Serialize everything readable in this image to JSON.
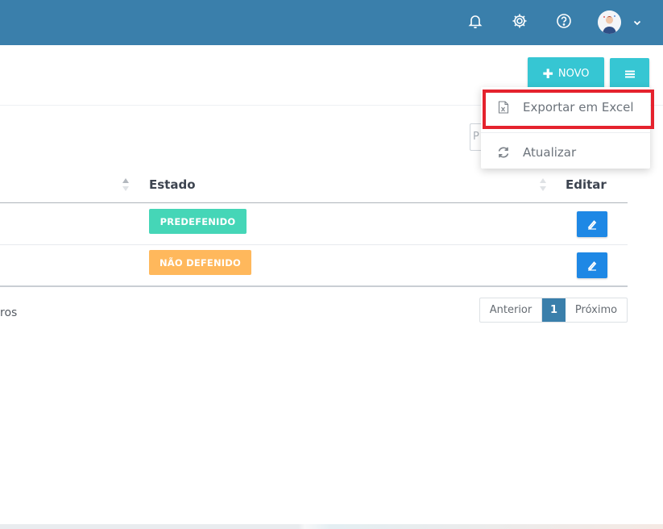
{
  "header": {
    "icons": [
      "bell-icon",
      "gear-icon",
      "help-icon",
      "avatar",
      "chevron-down-icon"
    ]
  },
  "toolbar": {
    "new_label": "NOVO"
  },
  "dropdown": {
    "items": [
      {
        "label": "Exportar em Excel",
        "icon": "excel-file-icon"
      },
      {
        "label": "Atualizar",
        "icon": "refresh-icon"
      }
    ]
  },
  "search": {
    "placeholder": "P"
  },
  "table": {
    "headers": {
      "estado": "Estado",
      "editar": "Editar"
    },
    "rows": [
      {
        "estado": "PREDEFENIDO",
        "estado_color": "#45d6b7"
      },
      {
        "estado": "NÃO DEFENIDO",
        "estado_color": "#ffb85c"
      }
    ]
  },
  "footer": {
    "info_fragment": "ros",
    "pagination": {
      "prev": "Anterior",
      "current": "1",
      "next": "Próximo"
    }
  },
  "colors": {
    "topbar": "#3a7fab",
    "accent": "#36c6d3",
    "edit": "#1e88e5",
    "highlight": "#e5222d"
  }
}
